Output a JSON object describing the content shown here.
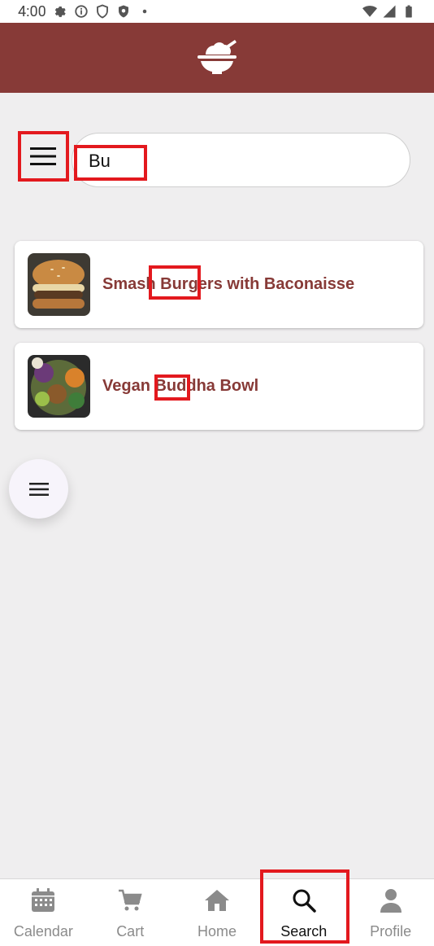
{
  "status_bar": {
    "time": "4:00"
  },
  "search": {
    "value": "Bu"
  },
  "results": [
    {
      "title": "Smash Burgers with Baconaisse"
    },
    {
      "title": "Vegan Buddha Bowl"
    }
  ],
  "bottom_nav": [
    {
      "label": "Calendar",
      "icon": "calendar-icon",
      "active": false
    },
    {
      "label": "Cart",
      "icon": "cart-icon",
      "active": false
    },
    {
      "label": "Home",
      "icon": "home-icon",
      "active": false
    },
    {
      "label": "Search",
      "icon": "search-icon",
      "active": true
    },
    {
      "label": "Profile",
      "icon": "profile-icon",
      "active": false
    }
  ],
  "colors": {
    "header": "#873a37",
    "accent_text": "#873a37",
    "highlight": "#e3191e",
    "background": "#efeeef"
  }
}
